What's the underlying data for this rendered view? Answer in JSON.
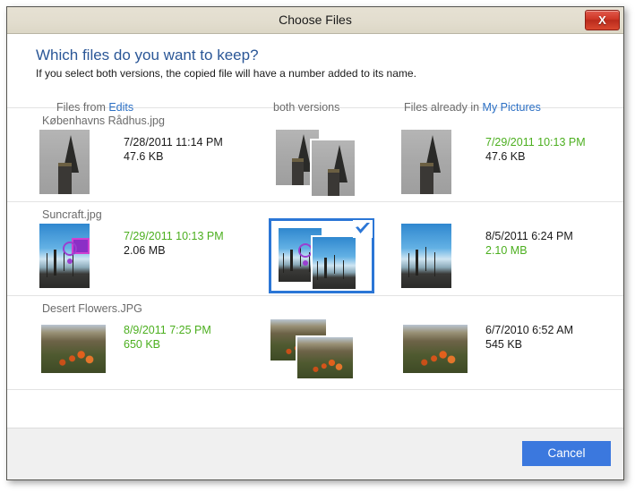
{
  "window": {
    "title": "Choose Files",
    "close_glyph": "X"
  },
  "intro": {
    "heading": "Which files do you want to keep?",
    "subheading": "If you select both versions, the copied file will have a number added to its name."
  },
  "columns": {
    "left_prefix": "Files from ",
    "left_link": "Edits",
    "middle": "both versions",
    "right_prefix": "Files already in ",
    "right_link": "My Pictures"
  },
  "rows": [
    {
      "name": "Københavns Rådhus.jpg",
      "left": {
        "date": "7/28/2011 11:14 PM",
        "size": "47.6 KB",
        "date_highlight": false,
        "size_highlight": false
      },
      "right": {
        "date": "7/29/2011 10:13 PM",
        "size": "47.6 KB",
        "date_highlight": true,
        "size_highlight": false
      },
      "selected": false
    },
    {
      "name": "Suncraft.jpg",
      "left": {
        "date": "7/29/2011 10:13 PM",
        "size": "2.06 MB",
        "date_highlight": true,
        "size_highlight": false
      },
      "right": {
        "date": "8/5/2011 6:24 PM",
        "size": "2.10 MB",
        "date_highlight": false,
        "size_highlight": true
      },
      "selected": true
    },
    {
      "name": "Desert Flowers.JPG",
      "left": {
        "date": "8/9/2011 7:25 PM",
        "size": "650 KB",
        "date_highlight": true,
        "size_highlight": true
      },
      "right": {
        "date": "6/7/2010 6:52 AM",
        "size": "545 KB",
        "date_highlight": false,
        "size_highlight": false
      },
      "selected": false
    }
  ],
  "footer": {
    "cancel_label": "Cancel"
  },
  "colors": {
    "accent": "#3b78de",
    "selection_border": "#2b76d6",
    "link": "#2b6fc4",
    "heading": "#2b5797",
    "highlight_green": "#4caf1f",
    "close_red": "#cf3626",
    "titlebar": "#e2ddce"
  }
}
